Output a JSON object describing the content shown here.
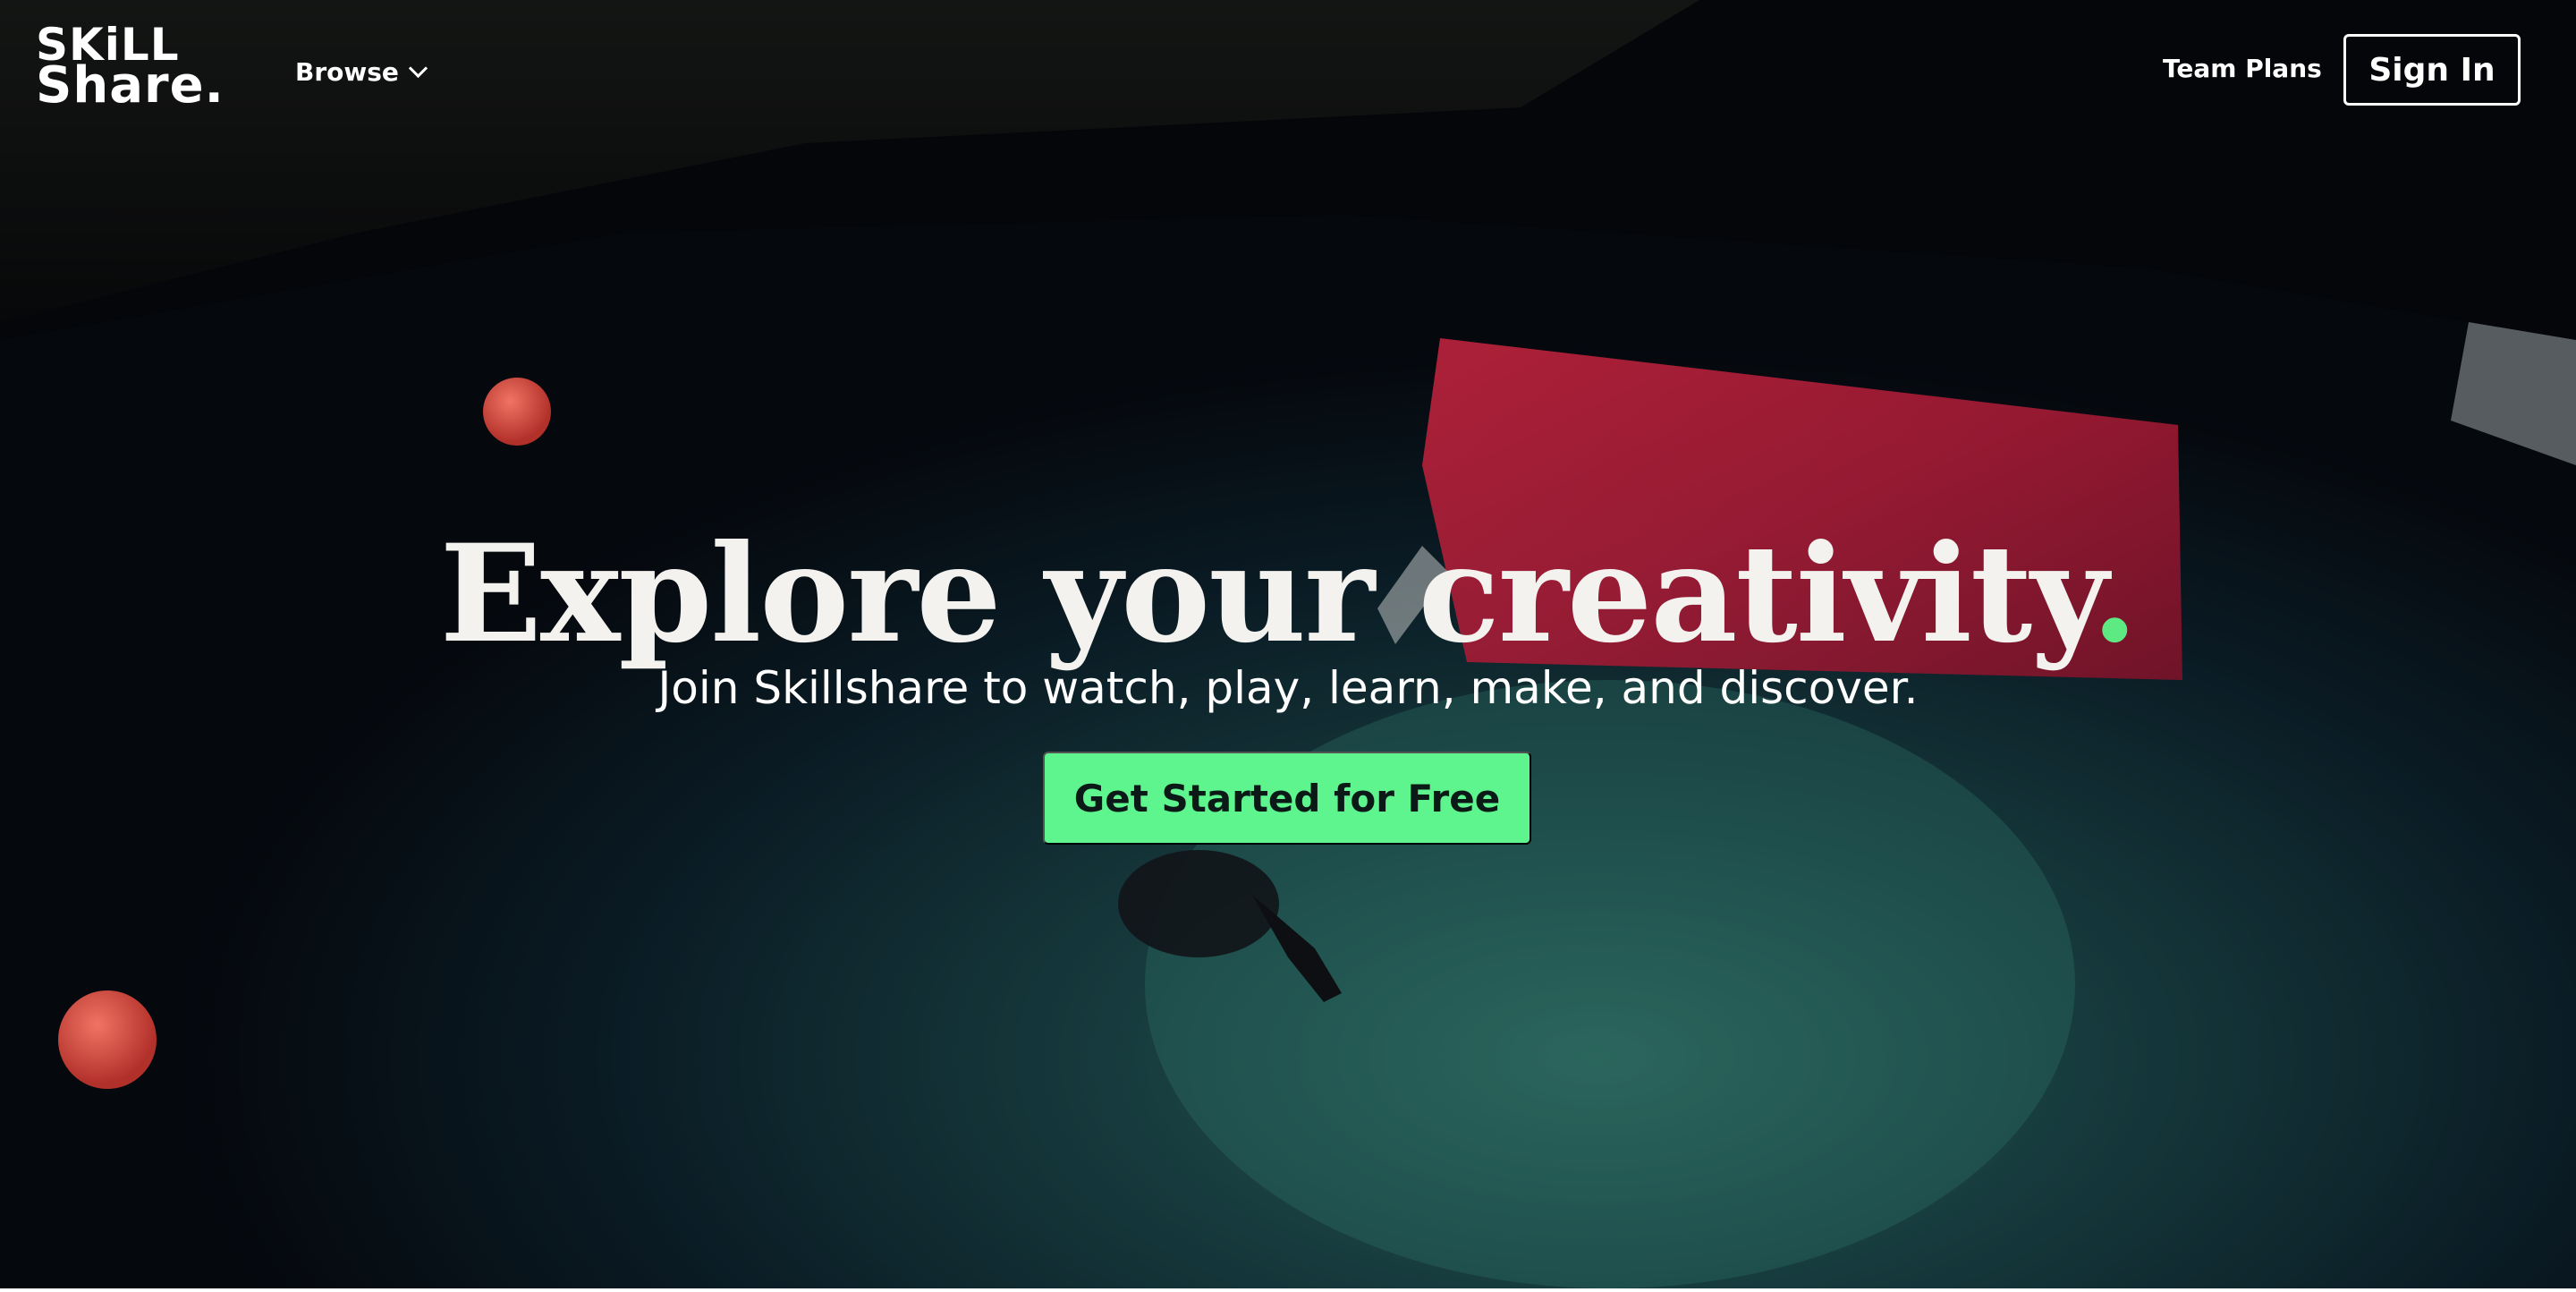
{
  "header": {
    "logo_line1": "SKiLL",
    "logo_line2": "Share.",
    "browse_label": "Browse",
    "team_plans_label": "Team Plans",
    "sign_in_label": "Sign In"
  },
  "hero": {
    "title": "Explore your creativity",
    "title_dot": ".",
    "subtitle": "Join Skillshare to watch, play, learn, make, and discover.",
    "cta_label": "Get Started for Free"
  },
  "colors": {
    "accent_green": "#5ef58f",
    "title_dot": "#5eea83",
    "background": "#04060a"
  }
}
